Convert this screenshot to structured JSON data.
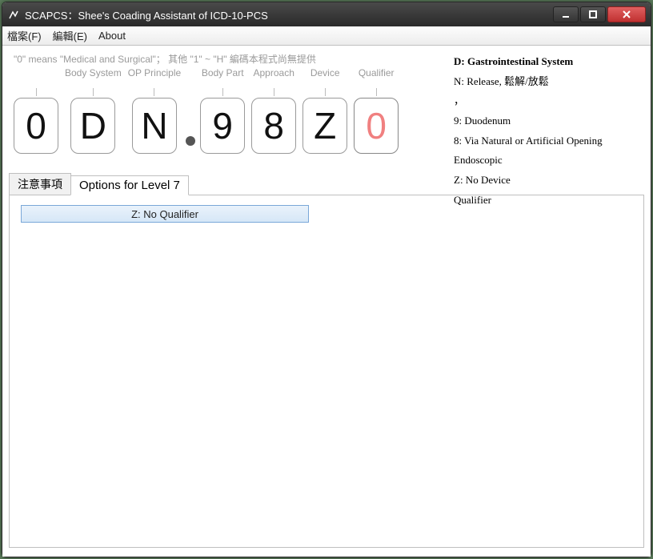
{
  "window": {
    "title": "SCAPCS：Shee's Coading Assistant of ICD-10-PCS"
  },
  "menu": {
    "file": "檔案(F)",
    "edit": "編輯(E)",
    "about": "About"
  },
  "hint": "\"0\" means \"Medical and Surgical\"；  其他 \"1\" ~ \"H\" 編碼本程式尚無提供",
  "columns": {
    "c1": {
      "label": "",
      "value": "0"
    },
    "c2": {
      "label": "Body System",
      "value": "D"
    },
    "c3": {
      "label": "OP Principle",
      "value": "N"
    },
    "c4": {
      "label": "Body Part",
      "value": "9"
    },
    "c5": {
      "label": "Approach",
      "value": "8"
    },
    "c6": {
      "label": "Device",
      "value": "Z"
    },
    "c7": {
      "label": "Qualifier",
      "value": "0"
    }
  },
  "info": {
    "l1": "D: Gastrointestinal System",
    "l2": "N: Release, 鬆解/放鬆",
    "l3": "，",
    "l4": "9: Duodenum",
    "l5": "8: Via Natural or Artificial Opening Endoscopic",
    "l6": "Z: No Device",
    "l7": "Qualifier"
  },
  "tabs": {
    "notes": "注意事項",
    "options": "Options for Level 7"
  },
  "options": {
    "item1": "Z: No Qualifier"
  }
}
